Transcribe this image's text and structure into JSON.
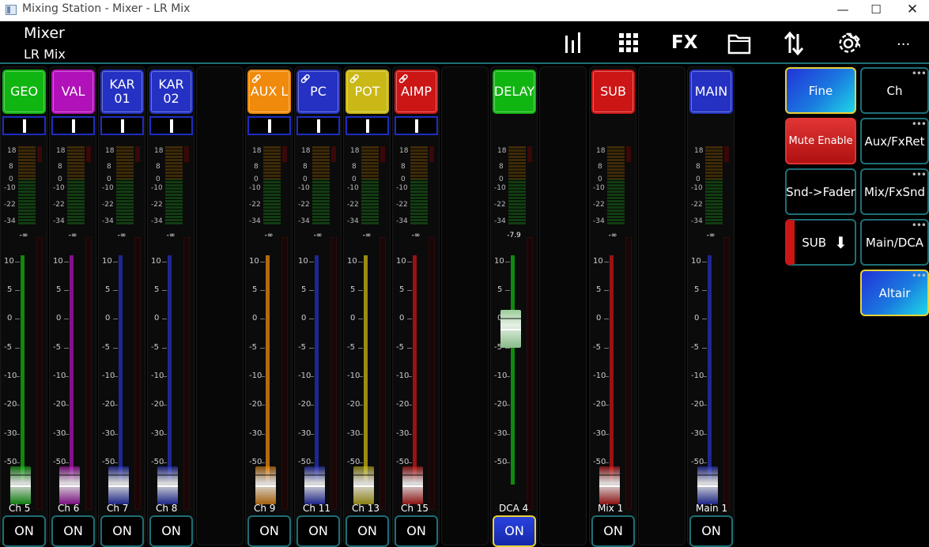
{
  "window": {
    "title": "Mixing Station - Mixer - LR Mix"
  },
  "toolbar": {
    "title": "Mixer",
    "subtitle": "LR Mix",
    "fx_label": "FX",
    "more_label": "...",
    "icons": [
      "meters-icon",
      "grid-icon",
      "fx-icon",
      "folder-icon",
      "swap-icon",
      "gear-icon",
      "more-icon"
    ]
  },
  "scale": {
    "meter": [
      "18",
      "8",
      "0",
      "-10",
      "-22",
      "-34"
    ],
    "fader": [
      "10",
      "5",
      "0",
      "-5",
      "-10",
      "-20",
      "-30",
      "-50"
    ]
  },
  "channels": [
    {
      "name": "GEO",
      "color": "#11b511",
      "volume": "-∞",
      "label": "Ch 5",
      "on_label": "ON",
      "on_active": false,
      "linked": false,
      "pan": 0.5,
      "fader": 0.0
    },
    {
      "name": "VAL",
      "color": "#b111b8",
      "volume": "-∞",
      "label": "Ch 6",
      "on_label": "ON",
      "on_active": false,
      "linked": false,
      "pan": 0.5,
      "fader": 0.0
    },
    {
      "name": "KAR 01",
      "color": "#2431c2",
      "volume": "-∞",
      "label": "Ch 7",
      "on_label": "ON",
      "on_active": false,
      "linked": false,
      "pan": 0.5,
      "fader": 0.0
    },
    {
      "name": "KAR 02",
      "color": "#2431c2",
      "volume": "-∞",
      "label": "Ch 8",
      "on_label": "ON",
      "on_active": false,
      "linked": false,
      "pan": 0.5,
      "fader": 0.0
    },
    {
      "name": "AUX L",
      "color": "#f08a0c",
      "volume": "-∞",
      "label": "Ch 9",
      "on_label": "ON",
      "on_active": false,
      "linked": true,
      "pan": 0.5,
      "fader": 0.0
    },
    {
      "name": "PC",
      "color": "#2431c2",
      "volume": "-∞",
      "label": "Ch 11",
      "on_label": "ON",
      "on_active": false,
      "linked": true,
      "pan": 0.5,
      "fader": 0.0
    },
    {
      "name": "POT",
      "color": "#c9b816",
      "volume": "-∞",
      "label": "Ch 13",
      "on_label": "ON",
      "on_active": false,
      "linked": true,
      "pan": 0.5,
      "fader": 0.0
    },
    {
      "name": "AIMP",
      "color": "#cc1515",
      "volume": "-∞",
      "label": "Ch 15",
      "on_label": "ON",
      "on_active": false,
      "linked": true,
      "pan": 0.5,
      "fader": 0.0
    },
    {
      "name": "DELAY",
      "color": "#11b511",
      "volume": "-7.9",
      "label": "DCA 4",
      "on_label": "ON",
      "on_active": true,
      "linked": false,
      "pan": null,
      "fader": 0.72
    },
    {
      "name": "SUB",
      "color": "#cc1515",
      "volume": "-∞",
      "label": "Mix 1",
      "on_label": "ON",
      "on_active": false,
      "linked": false,
      "pan": null,
      "fader": 0.0
    },
    {
      "name": "MAIN",
      "color": "#2431c2",
      "volume": "-∞",
      "label": "Main 1",
      "on_label": "ON",
      "on_active": false,
      "linked": false,
      "pan": null,
      "fader": 0.0
    }
  ],
  "side_buttons": [
    {
      "label": "Fine",
      "style": "fine",
      "dots": false
    },
    {
      "label": "Ch",
      "style": "plain",
      "dots": true
    },
    {
      "label": "Mute Enable",
      "style": "mute",
      "dots": false
    },
    {
      "label": "Aux/FxRet",
      "style": "plain",
      "dots": true
    },
    {
      "label": "Snd->Fader",
      "style": "plain",
      "dots": false
    },
    {
      "label": "Mix/FxSnd",
      "style": "plain",
      "dots": true
    },
    {
      "label": "SUB",
      "style": "sub",
      "dots": false
    },
    {
      "label": "Main/DCA",
      "style": "plain",
      "dots": true
    },
    {
      "label": "Altair",
      "style": "fine",
      "dots": true
    }
  ]
}
